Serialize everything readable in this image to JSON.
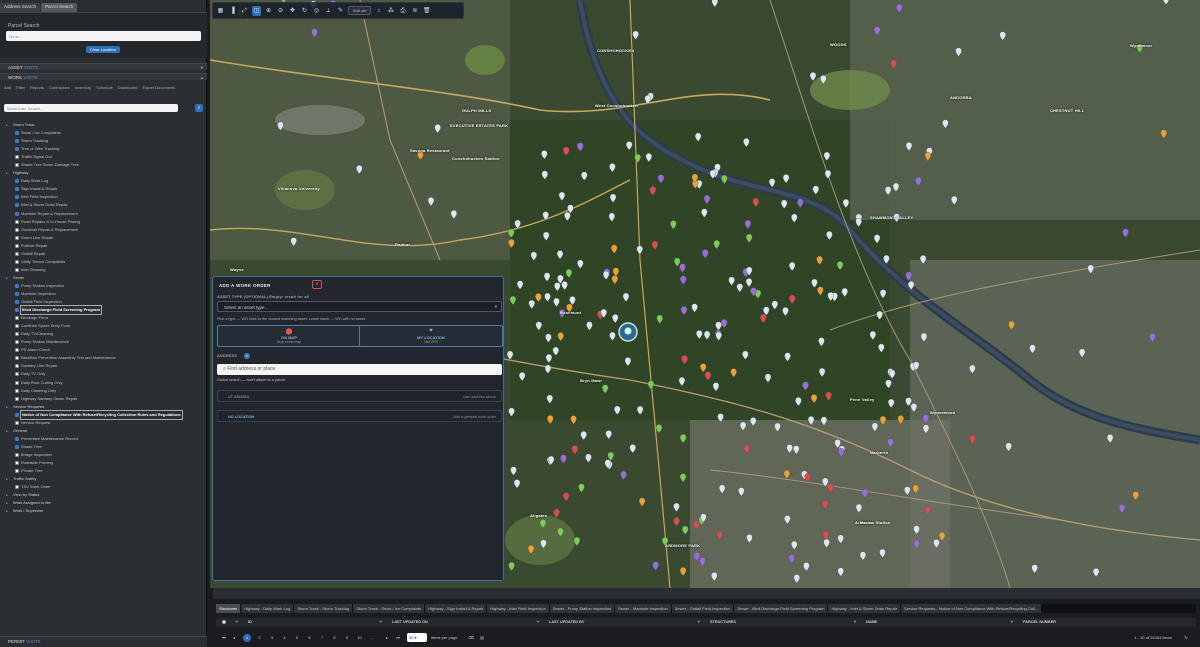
{
  "left_panel": {
    "tabs": [
      "Address Search",
      "Parcel Search"
    ],
    "parcel_search": {
      "title": "Parcel Search",
      "placeholder": "Go to...",
      "clear_button": "Clear Location"
    },
    "sections": {
      "asset": {
        "title": "ASSET",
        "sub": "VISITS"
      },
      "work": {
        "title": "WORK",
        "sub": "VISITS"
      },
      "permit": {
        "title": "PERMIT",
        "sub": "VISITS"
      }
    },
    "work_nav": [
      "Add",
      "Filter",
      "Reports",
      "Contractors",
      "Inventory",
      "Schedule",
      "Dashboard",
      "Export Documents"
    ],
    "work_search_placeholder": "WorkOrder Search...",
    "tree": [
      {
        "label": "Storm Track",
        "type": "group"
      },
      {
        "label": "Snow / Ice Complaints",
        "checked": true
      },
      {
        "label": "Storm Tracking",
        "checked": true
      },
      {
        "label": "Tree or Wire Tracking",
        "checked": true
      },
      {
        "label": "Traffic Signal Out",
        "checked": false
      },
      {
        "label": "Shade Tree Storm Damage Tree",
        "checked": false
      },
      {
        "label": "Highway",
        "type": "group"
      },
      {
        "label": "Daily Work Log",
        "checked": true
      },
      {
        "label": "Sign Install & Repair",
        "checked": true
      },
      {
        "label": "Inlet Field Inspection",
        "checked": true
      },
      {
        "label": "Inlet & Storm Drain Repair",
        "checked": true
      },
      {
        "label": "Manhole Repair & Replacement",
        "checked": true
      },
      {
        "label": "Road Repairs & In-House Paving",
        "checked": false
      },
      {
        "label": "Guiderail Repair & Replacement",
        "checked": false
      },
      {
        "label": "Storm Line Repair",
        "checked": false
      },
      {
        "label": "Pothole Repair",
        "checked": false
      },
      {
        "label": "Outfall Repair",
        "checked": false
      },
      {
        "label": "Utility Trench Complaints",
        "checked": false
      },
      {
        "label": "Inlet Cleaning",
        "checked": false
      },
      {
        "label": "Sewer",
        "type": "group"
      },
      {
        "label": "Pump Station Inspection",
        "checked": true
      },
      {
        "label": "Manhole Inspection",
        "checked": true
      },
      {
        "label": "Outfall Field Inspection",
        "checked": true
      },
      {
        "label": "Illicit Discharge Field Screening Program",
        "checked": true,
        "highlight": true
      },
      {
        "label": "Blockage Form",
        "checked": false
      },
      {
        "label": "Confined Space Entry Form",
        "checked": false
      },
      {
        "label": "Daily TV/Cleaning",
        "checked": false
      },
      {
        "label": "Pump Station Maintenance",
        "checked": false
      },
      {
        "label": "PS Alarm Check",
        "checked": false
      },
      {
        "label": "Backflow Prevention Assembly Test and Maintenance",
        "checked": false
      },
      {
        "label": "Sanitary Line Repair",
        "checked": false
      },
      {
        "label": "Daily TV Only",
        "checked": false
      },
      {
        "label": "Daily Root Cutting Only",
        "checked": false
      },
      {
        "label": "Daily Cleaning Only",
        "checked": false
      },
      {
        "label": "Highway Sanitary Sewer Repair",
        "checked": false
      },
      {
        "label": "Service Requests",
        "type": "group"
      },
      {
        "label": "Notice of Non Compliance With Refuse/Recycling Collection Rules and Regulations",
        "checked": true,
        "highlight": true
      },
      {
        "label": "Service Request",
        "checked": false
      },
      {
        "label": "General",
        "type": "group"
      },
      {
        "label": "Preventive Maintenance Record",
        "checked": true
      },
      {
        "label": "Shade Tree",
        "checked": true
      },
      {
        "label": "Bridge Inspection",
        "checked": false
      },
      {
        "label": "Roadside Pruning",
        "checked": false
      },
      {
        "label": "Private Tree",
        "checked": false
      },
      {
        "label": "Traffic Safety",
        "type": "group"
      },
      {
        "label": "TSU Work Order",
        "checked": false
      },
      {
        "label": "View by Status",
        "type": "group"
      },
      {
        "label": "Work Assigned to Me",
        "type": "group"
      },
      {
        "label": "Work I Supervise",
        "type": "group"
      }
    ]
  },
  "map": {
    "toolbar": {
      "dropdown": "Edit ctrl"
    },
    "labels": [
      "CONSHOHOCKEN",
      "GULPH MILLS",
      "EXECUTIVE ESTATES PARK",
      "West Conshohocken",
      "Conshohocken Station",
      "Savona Restaurant",
      "Villanova University",
      "Radnor",
      "Wayne",
      "Rosemont",
      "Bryn Mawr",
      "Penn Valley",
      "Narberth",
      "Wynnewood",
      "Ardmore",
      "Haverford",
      "Merion Station",
      "Wyndmoor",
      "ANDORRA",
      "SHAWMONT VALLEY",
      "Allgates",
      "ARDMORE PARK",
      "WOODS",
      "CHESTNUT HILL",
      "Pike Creek"
    ]
  },
  "dialog": {
    "title": "ADD A WORK ORDER",
    "asset_type_label": "ASSET TYPE (OPTIONAL)  Empty: result for all",
    "asset_select": "Select an asset type...",
    "help": "Pick a type → WO links to the closest matching asset. Leave blank → WO with no asset.",
    "on_map": {
      "label": "ON MAP",
      "sub": "Drop on the map"
    },
    "my_location": {
      "label": "MY LOCATION",
      "sub": "Use GPS"
    },
    "address_label": "ADDRESS",
    "address_placeholder": "Find address or place",
    "global_search_note": "Global search — won't attach to a parcel.",
    "row1": {
      "left": "UT 4354654",
      "right": "Use address above"
    },
    "row2": {
      "left": "NO LOCATION",
      "right": "Add a general work order"
    }
  },
  "bottom": {
    "tabs": [
      "Structures",
      "Highway - Daily Work Log",
      "Storm Track - Storm Tracking",
      "Storm Track - Snow / Ice Complaints",
      "Highway - Sign Install & Repair",
      "Highway - Inlet Field Inspection",
      "Sewer - Pump Station Inspection",
      "Sewer - Manhole Inspection",
      "Sewer - Outfall Field Inspection",
      "Sewer - Illicit Discharge Field Screening Program",
      "Highway - Inlet & Storm Drain Repair",
      "Service Requests - Notice of Non Compliance With Refuse/Recycling Coll..."
    ],
    "columns": [
      "ID",
      "LAST UPDATED ON",
      "LAST UPDATED BY",
      "STRUCTURES",
      "NAME",
      "PARCEL NUMBER"
    ],
    "pages": [
      "1",
      "2",
      "3",
      "4",
      "5",
      "6",
      "7",
      "8",
      "9",
      "10",
      "..."
    ],
    "per_page": "30",
    "per_page_label": "items per page",
    "count": "1 - 30 of 24434 items"
  }
}
